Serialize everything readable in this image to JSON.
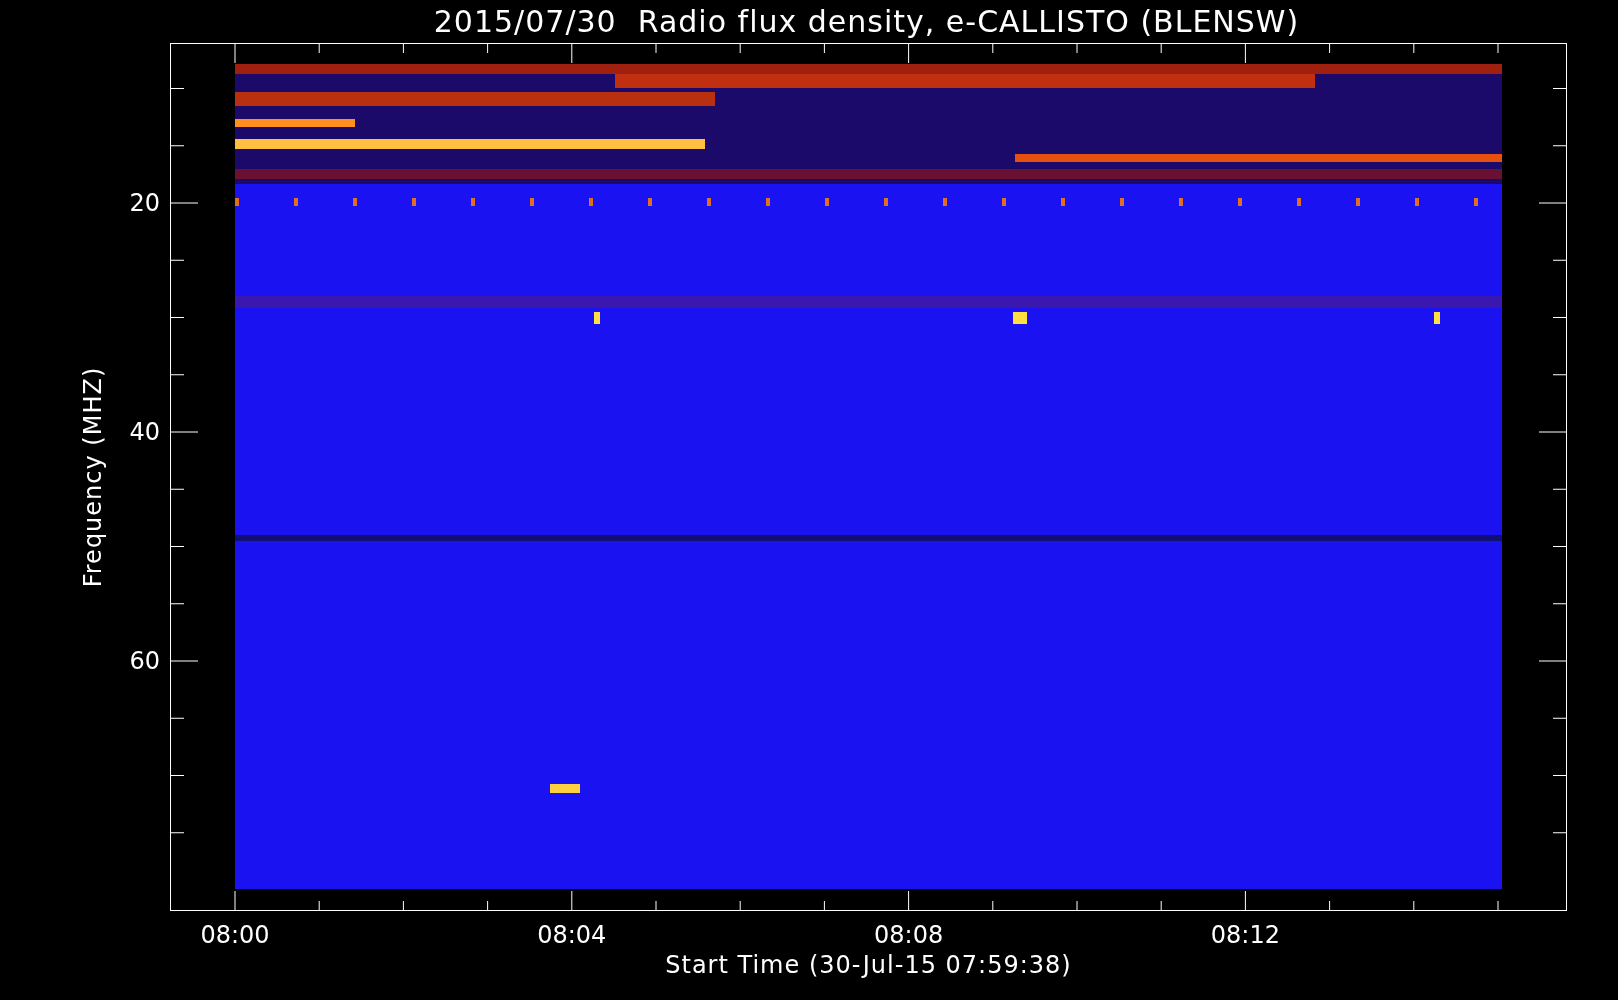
{
  "title": "2015/07/30  Radio flux density, e-CALLISTO (BLENSW)",
  "y_axis": {
    "label": "Frequency (MHZ)",
    "ticks": [
      "20",
      "40",
      "60"
    ]
  },
  "x_axis": {
    "label": "Start Time (30-Jul-15 07:59:38)",
    "ticks": [
      "08:00",
      "08:04",
      "08:08",
      "08:12"
    ]
  }
}
